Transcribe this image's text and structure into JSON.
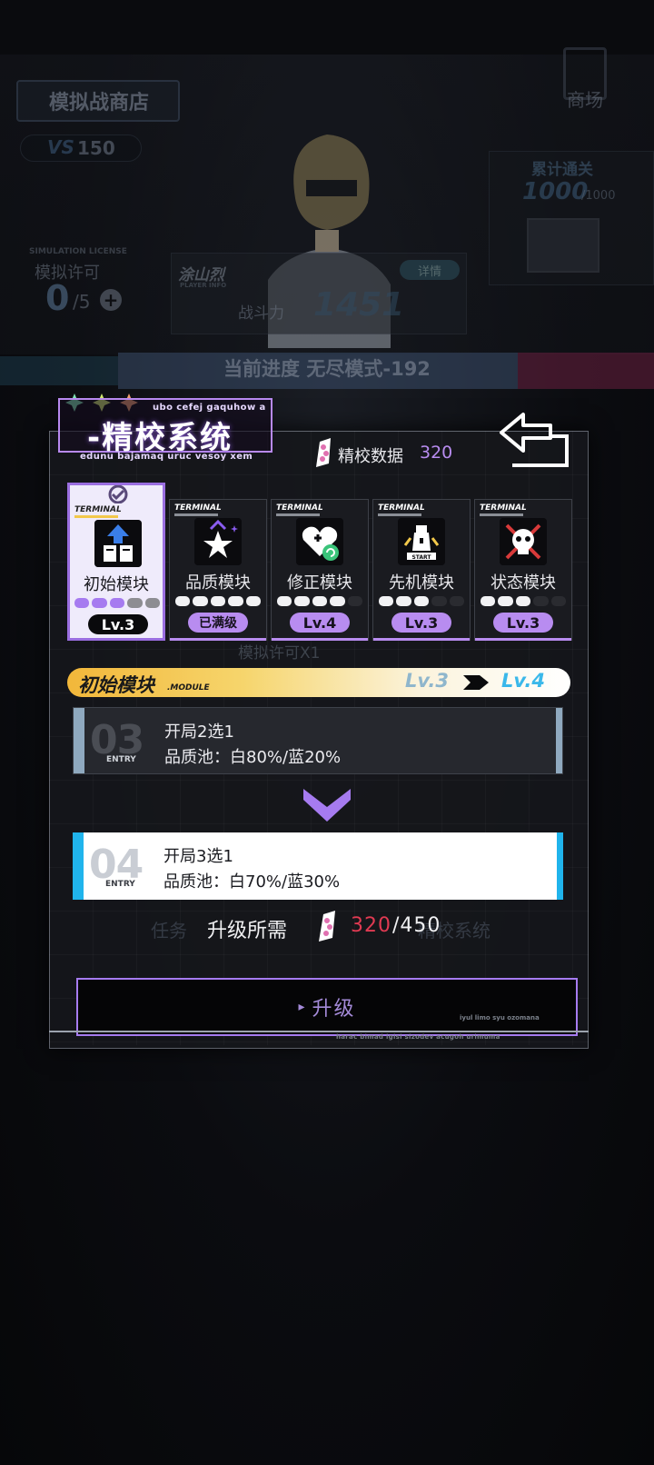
{
  "background": {
    "shop_title": "模拟战商店",
    "vs_value": "150",
    "license_en": "SIMULATION LICENSE",
    "license_label": "模拟许可",
    "license_count": "0",
    "license_max": "/5",
    "player_name": "涂山烈",
    "player_info": "PLAYER INFO",
    "detail_button": "详情",
    "power_label": "战斗力",
    "power_value": "1451",
    "market": "商场",
    "clear_label": "累计通关",
    "clear_value": "1000",
    "clear_max": "/1000",
    "progress_text": "当前进度 无尽模式-192",
    "under_license": "模拟许可X1",
    "menu_left": "任务",
    "menu_right": "精校系统"
  },
  "dialog": {
    "title": "-精校系统",
    "subtitle_top": "ubo cefej gaquhow a",
    "subtitle_bottom": "edunu bajamaq uruc vesoy xem",
    "data_label": "精校数据",
    "data_value": "320",
    "footer_small": "iyul limo syu ozomana",
    "footer_text": "harac bimad igisi sizodev acugoh urimuma"
  },
  "modules": [
    {
      "terminal": "TERMINAL",
      "name": "初始模块",
      "level": "Lv.3",
      "filled": 3,
      "total": 5,
      "selected": true
    },
    {
      "terminal": "TERMINAL",
      "name": "品质模块",
      "level": "已满级",
      "filled": 5,
      "total": 5,
      "selected": false
    },
    {
      "terminal": "TERMINAL",
      "name": "修正模块",
      "level": "Lv.4",
      "filled": 4,
      "total": 5,
      "selected": false
    },
    {
      "terminal": "TERMINAL",
      "name": "先机模块",
      "level": "Lv.3",
      "filled": 3,
      "total": 5,
      "selected": false
    },
    {
      "terminal": "TERMINAL",
      "name": "状态模块",
      "level": "Lv.3",
      "filled": 3,
      "total": 5,
      "selected": false
    }
  ],
  "upgrade": {
    "module_name": "初始模块",
    "module_sub": ".MODULE",
    "from_level": "Lv.3",
    "to_level": "Lv.4",
    "current": {
      "number": "03",
      "word": "ENTRY",
      "line1": "开局2选1",
      "line2": "品质池：白80%/蓝20%"
    },
    "next": {
      "number": "04",
      "word": "ENTRY",
      "line1": "开局3选1",
      "line2": "品质池：白70%/蓝30%"
    },
    "cost_label": "升级所需",
    "cost_have": "320",
    "cost_need": "/450",
    "button_label": "升级"
  },
  "colors": {
    "accent_purple": "#b88cf0",
    "accent_blue": "#20b4ec",
    "cost_red": "#e03a52",
    "header_gold": "#f2b73a"
  }
}
